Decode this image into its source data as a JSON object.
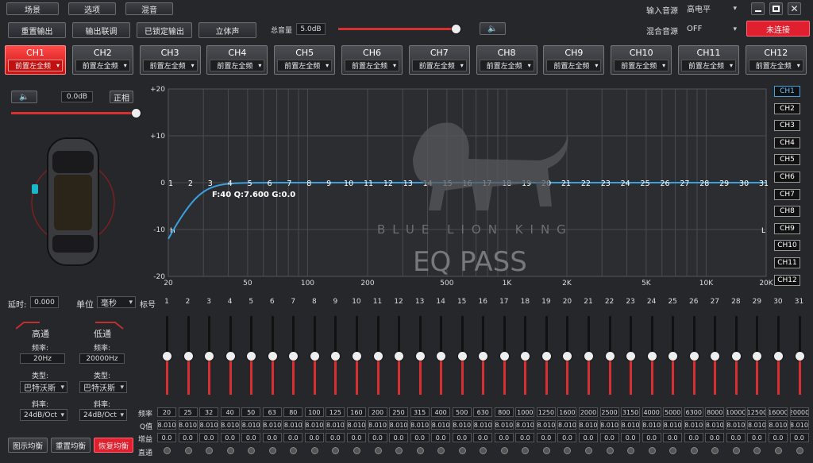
{
  "top_menu": {
    "scene": "场景",
    "options": "选项",
    "mix": "混音"
  },
  "input_source": {
    "label": "输入音源",
    "value": "高电平"
  },
  "mix_source": {
    "label": "混合音源",
    "value": "OFF"
  },
  "connect_button": "未连接",
  "toolbar": {
    "reset_output": "重置输出",
    "output_link": "输出联调",
    "locked_output": "已锁定输出",
    "stereo": "立体声",
    "master_volume_label": "总音量",
    "master_volume_value": "5.0dB",
    "master_volume_level": 0.96
  },
  "channels": [
    {
      "name": "CH1",
      "mode": "前置左全频"
    },
    {
      "name": "CH2",
      "mode": "前置左全频"
    },
    {
      "name": "CH3",
      "mode": "前置左全频"
    },
    {
      "name": "CH4",
      "mode": "前置左全频"
    },
    {
      "name": "CH5",
      "mode": "前置左全频"
    },
    {
      "name": "CH6",
      "mode": "前置左全频"
    },
    {
      "name": "CH7",
      "mode": "前置左全频"
    },
    {
      "name": "CH8",
      "mode": "前置左全频"
    },
    {
      "name": "CH9",
      "mode": "前置左全频"
    },
    {
      "name": "CH10",
      "mode": "前置左全频"
    },
    {
      "name": "CH11",
      "mode": "前置左全频"
    },
    {
      "name": "CH12",
      "mode": "前置左全频"
    }
  ],
  "active_channel": "CH1",
  "channel_panel": {
    "gain": "0.0dB",
    "phase": "正相",
    "gain_level": 0.98
  },
  "graph": {
    "y_ticks": [
      "+20",
      "+10",
      "0",
      "-10",
      "-20"
    ],
    "x_ticks": [
      "20",
      "50",
      "100",
      "200",
      "500",
      "1K",
      "2K",
      "5K",
      "10K",
      "20K"
    ],
    "h_label": "H",
    "l_label": "L",
    "point_info": "F:40 Q:7.600 G:0.0",
    "watermark_brand": "BLUE LION KING",
    "watermark_title": "EQ PASS",
    "curve_color": "#3aa0e0"
  },
  "delay": {
    "label": "延时:",
    "value": "0.000",
    "unit_label": "单位",
    "unit_value": "毫秒",
    "band_label": "标号"
  },
  "highpass": {
    "title": "高通",
    "freq_label": "频率:",
    "freq": "20Hz",
    "type_label": "类型:",
    "type": "巴特沃斯",
    "slope_label": "斜率:",
    "slope": "24dB/Oct"
  },
  "lowpass": {
    "title": "低通",
    "freq_label": "频率:",
    "freq": "20000Hz",
    "type_label": "类型:",
    "type": "巴特沃斯",
    "slope_label": "斜率:",
    "slope": "24dB/Oct"
  },
  "eq_buttons": {
    "graphic": "图示均衡",
    "reset": "重置均衡",
    "restore": "恢复均衡"
  },
  "row_labels": {
    "freq": "频率",
    "q": "Q值",
    "gain": "增益",
    "bypass": "直通"
  },
  "bands": {
    "numbers": [
      "1",
      "2",
      "3",
      "4",
      "5",
      "6",
      "7",
      "8",
      "9",
      "10",
      "11",
      "12",
      "13",
      "14",
      "15",
      "16",
      "17",
      "18",
      "19",
      "20",
      "21",
      "22",
      "23",
      "24",
      "25",
      "26",
      "27",
      "28",
      "29",
      "30",
      "31"
    ],
    "freqs": [
      "20",
      "25",
      "32",
      "40",
      "50",
      "63",
      "80",
      "100",
      "125",
      "160",
      "200",
      "250",
      "315",
      "400",
      "500",
      "630",
      "800",
      "1000",
      "1250",
      "1600",
      "2000",
      "2500",
      "3150",
      "4000",
      "5000",
      "6300",
      "8000",
      "10000",
      "12500",
      "16000",
      "20000"
    ],
    "q": "8.010",
    "gain": "0.0",
    "level": 0.5
  }
}
